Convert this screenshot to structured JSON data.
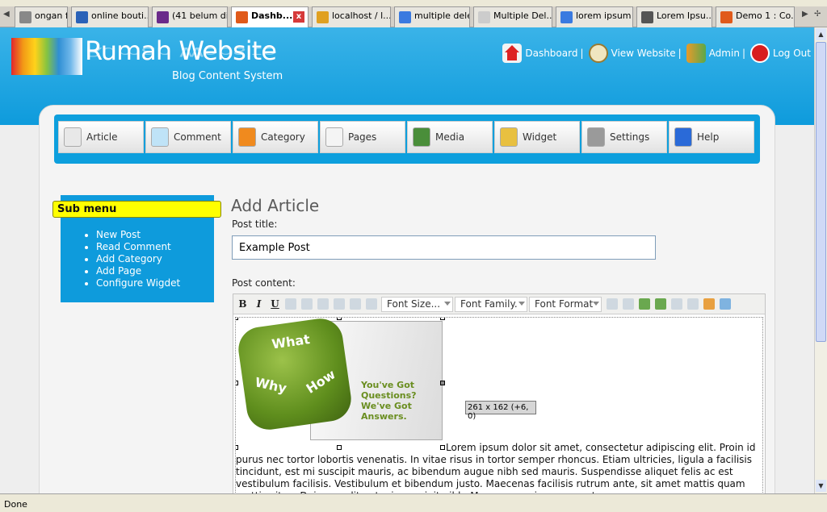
{
  "browser": {
    "tabs": [
      {
        "label": "ongan f...",
        "color": "#888888"
      },
      {
        "label": "online bouti...",
        "color": "#2a62b8"
      },
      {
        "label": "(41 belum di...",
        "color": "#6a2a8a"
      },
      {
        "label": "Dashb...",
        "color": "#e05a1a",
        "active": true
      },
      {
        "label": "localhost / l...",
        "color": "#e0a020"
      },
      {
        "label": "multiple dele...",
        "color": "#3a7ae0"
      },
      {
        "label": "Multiple Del...",
        "color": "#cccccc"
      },
      {
        "label": "lorem ipsum ...",
        "color": "#3a7ae0"
      },
      {
        "label": "Lorem Ipsu...",
        "color": "#555555"
      },
      {
        "label": "Demo 1 : Co...",
        "color": "#e05a1a"
      }
    ],
    "close_glyph": "x",
    "status": "Done"
  },
  "site": {
    "title": "Rumah Website",
    "subtitle": "Blog Content System"
  },
  "topnav": {
    "dashboard": "Dashboard",
    "view_website": "View Website",
    "admin": "Admin",
    "logout": "Log Out",
    "separator": "|"
  },
  "menu": [
    {
      "label": "Article",
      "icon": "pencil-icon",
      "color": "#e8e8e8"
    },
    {
      "label": "Comment",
      "icon": "speech-bubble-icon",
      "color": "#bfe3f7"
    },
    {
      "label": "Category",
      "icon": "notepad-icon",
      "color": "#f08a1e"
    },
    {
      "label": "Pages",
      "icon": "page-icon",
      "color": "#f4f4f4"
    },
    {
      "label": "Media",
      "icon": "media-icon",
      "color": "#4a8e3a"
    },
    {
      "label": "Widget",
      "icon": "widget-icon",
      "color": "#e8c040"
    },
    {
      "label": "Settings",
      "icon": "gear-icon",
      "color": "#9a9a9a"
    },
    {
      "label": "Help",
      "icon": "help-icon",
      "color": "#2a6ad8"
    }
  ],
  "submenu": {
    "title": "Sub menu",
    "items": [
      "New Post",
      "Read Comment",
      "Add Category",
      "Add Page",
      "Configure Wigdet"
    ]
  },
  "form": {
    "page_title": "Add Article",
    "post_title_label": "Post title:",
    "post_title_value": "Example Post",
    "post_content_label": "Post content:"
  },
  "editor": {
    "bold": "B",
    "italic": "I",
    "underline": "U",
    "font_size": "Font Size...",
    "font_family": "Font Family.",
    "font_format": "Font Format",
    "image_size_tip": "261 x 162 (+6, 0)",
    "image_text": {
      "what": "What",
      "why": "Why",
      "how": "How",
      "card_lines": [
        "You've Got",
        "Questions?",
        "We've Got",
        "Answers."
      ]
    },
    "body_text": "Lorem ipsum dolor sit amet, consectetur adipiscing elit. Proin id purus nec tortor lobortis venenatis. In vitae risus in tortor semper rhoncus. Etiam ultricies, ligula a facilisis tincidunt, est mi suscipit mauris, ac bibendum augue nibh sed mauris. Suspendisse aliquet felis ac est vestibulum facilisis. Vestibulum et bibendum justo. Maecenas facilisis rutrum ante, sit amet mattis quam mattis vitae. Duis nec elit ante, in suscipit nibh. Maecenas quis consequat purus."
  },
  "colors": {
    "header": "#0e9bdc",
    "submenu_title": "#ffff00"
  }
}
